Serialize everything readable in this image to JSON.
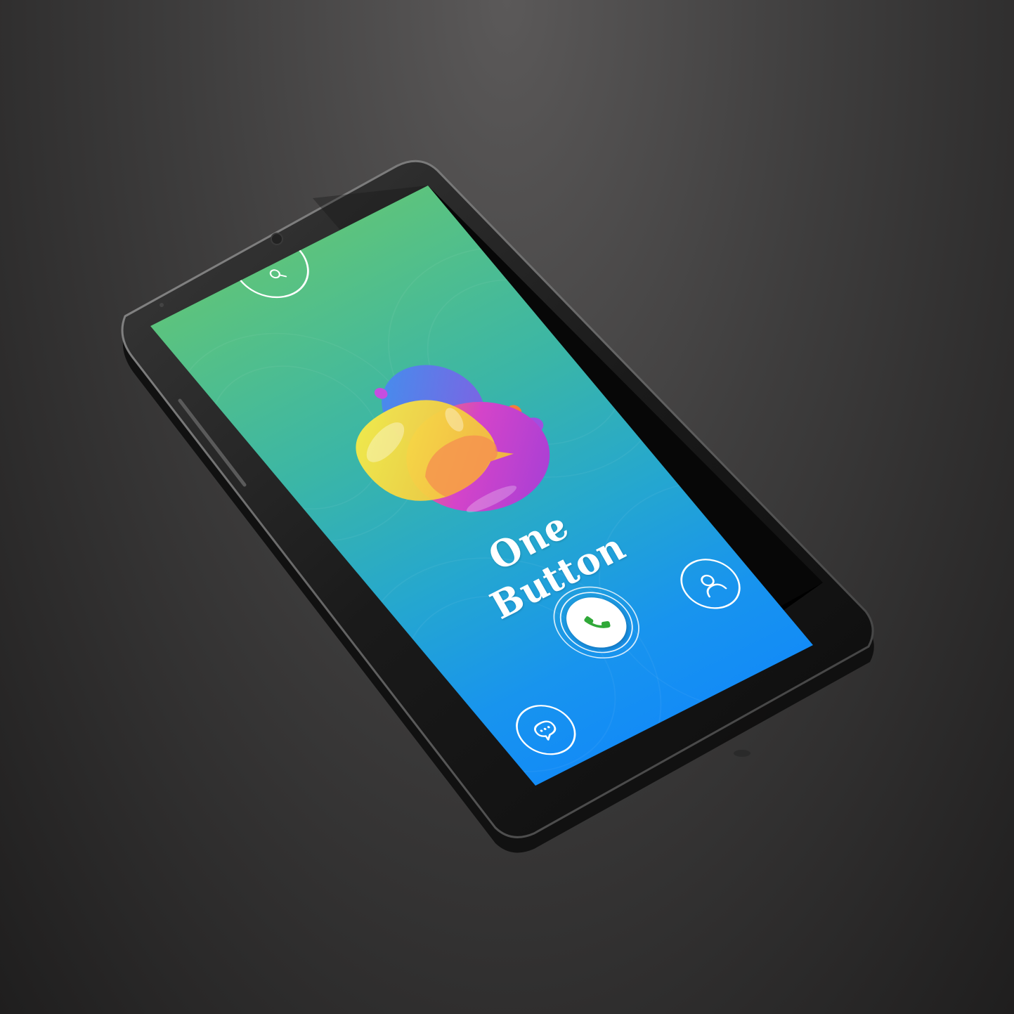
{
  "app": {
    "name": "One Button"
  },
  "screen": {
    "gradient_top": "#5cc37e",
    "gradient_bottom": "#138cf6"
  },
  "buttons": {
    "search": {
      "icon": "search-icon"
    },
    "call": {
      "icon": "phone-icon",
      "color": "#2fa838"
    },
    "contacts": {
      "icon": "user-icon"
    },
    "messages": {
      "icon": "chat-bubble-icon"
    }
  },
  "logo": {
    "icon": "chat-bubbles-logo",
    "colors": [
      "#f6e33a",
      "#f7904a",
      "#c53bd6",
      "#4b8ef6",
      "#a44fe0",
      "#f37d3a"
    ]
  }
}
